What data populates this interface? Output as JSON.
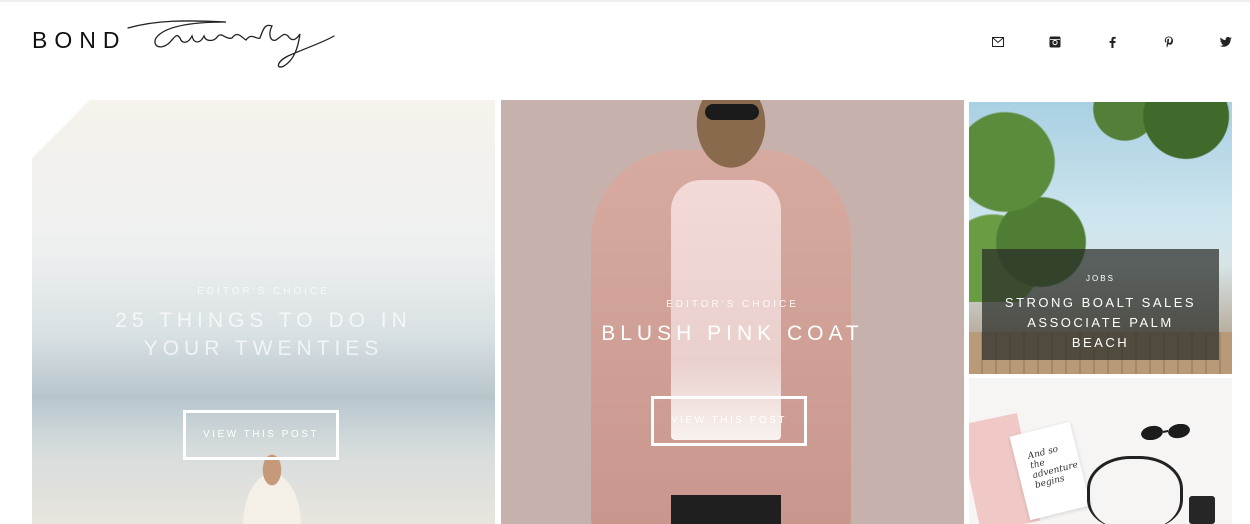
{
  "brand": {
    "bond": "BOND",
    "twenty": "Twenty"
  },
  "social": [
    {
      "icon": "mail-icon"
    },
    {
      "icon": "instagram-icon"
    },
    {
      "icon": "facebook-icon"
    },
    {
      "icon": "pinterest-icon"
    },
    {
      "icon": "twitter-icon"
    }
  ],
  "posts": [
    {
      "kicker": "EDITOR'S CHOICE",
      "title": "25 THINGS TO DO IN YOUR TWENTIES",
      "button": "VIEW THIS POST"
    },
    {
      "kicker": "EDITOR'S CHOICE",
      "title": "BLUSH PINK COAT",
      "button": "VIEW THIS POST"
    },
    {
      "kicker": "JOBS",
      "title": "STRONG BOALT SALES ASSOCIATE PALM BEACH"
    }
  ],
  "card_text": "And so the adventure begins"
}
